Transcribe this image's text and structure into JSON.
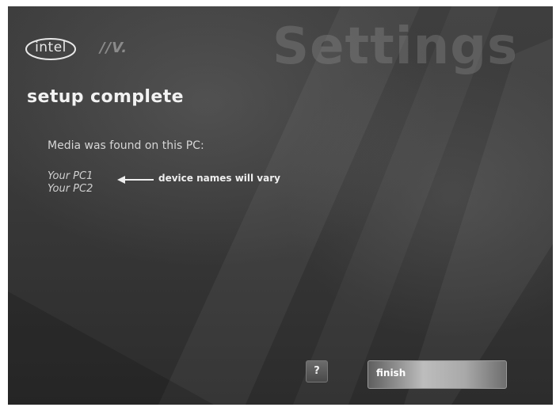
{
  "brand": {
    "intel": "intel",
    "viiv": "//V."
  },
  "header": {
    "watermark": "Settings"
  },
  "main": {
    "title": "setup complete",
    "media_found_label": "Media was found on this PC:",
    "devices": [
      "Your PC1",
      "Your PC2"
    ],
    "note": "device names will vary"
  },
  "footer": {
    "help_label": "?",
    "finish_label": "finish"
  },
  "icons": {
    "logo": "intel-logo",
    "arrow": "left-arrow-icon",
    "help": "help-icon"
  },
  "colors": {
    "background": "#3a3a3a",
    "text": "#f2f2f2",
    "button_highlight": "#bdbdbd"
  }
}
